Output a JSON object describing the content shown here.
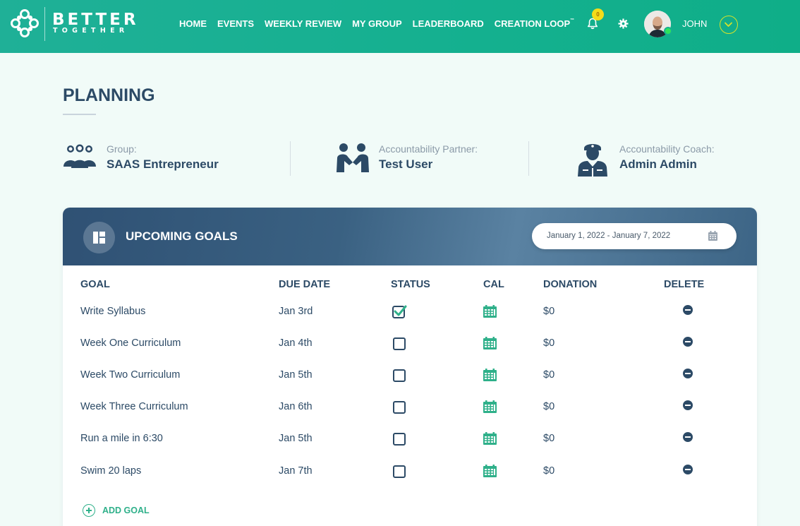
{
  "header": {
    "logo_line1": "BETTER",
    "logo_line2": "TOGETHER",
    "nav": [
      "HOME",
      "EVENTS",
      "WEEKLY REVIEW",
      "MY GROUP",
      "LEADERBOARD",
      "CREATION LOOP"
    ],
    "creation_loop_mark": "™",
    "notification_count": "0",
    "username": "JOHN"
  },
  "page": {
    "title": "PLANNING"
  },
  "info": {
    "group_label": "Group:",
    "group_value": "SAAS Entrepreneur",
    "partner_label": "Accountability Partner:",
    "partner_value": "Test User",
    "coach_label": "Accountability Coach:",
    "coach_value": "Admin Admin"
  },
  "goals": {
    "title": "UPCOMING GOALS",
    "date_range": "January 1, 2022 - January 7, 2022",
    "columns": [
      "GOAL",
      "DUE DATE",
      "STATUS",
      "CAL",
      "DONATION",
      "DELETE"
    ],
    "rows": [
      {
        "goal": "Write Syllabus",
        "due": "Jan 3rd",
        "done": true,
        "donation": "$0"
      },
      {
        "goal": "Week One Curriculum",
        "due": "Jan 4th",
        "done": false,
        "donation": "$0"
      },
      {
        "goal": "Week Two Curriculum",
        "due": "Jan 5th",
        "done": false,
        "donation": "$0"
      },
      {
        "goal": "Week Three Curriculum",
        "due": "Jan 6th",
        "done": false,
        "donation": "$0"
      },
      {
        "goal": "Run a mile in 6:30",
        "due": "Jan 5th",
        "done": false,
        "donation": "$0"
      },
      {
        "goal": "Swim 20 laps",
        "due": "Jan 7th",
        "done": false,
        "donation": "$0"
      }
    ],
    "add_label": "ADD GOAL"
  },
  "colors": {
    "header": "#14b08f",
    "primary": "#2c4a66",
    "accent": "#2fb08a"
  }
}
